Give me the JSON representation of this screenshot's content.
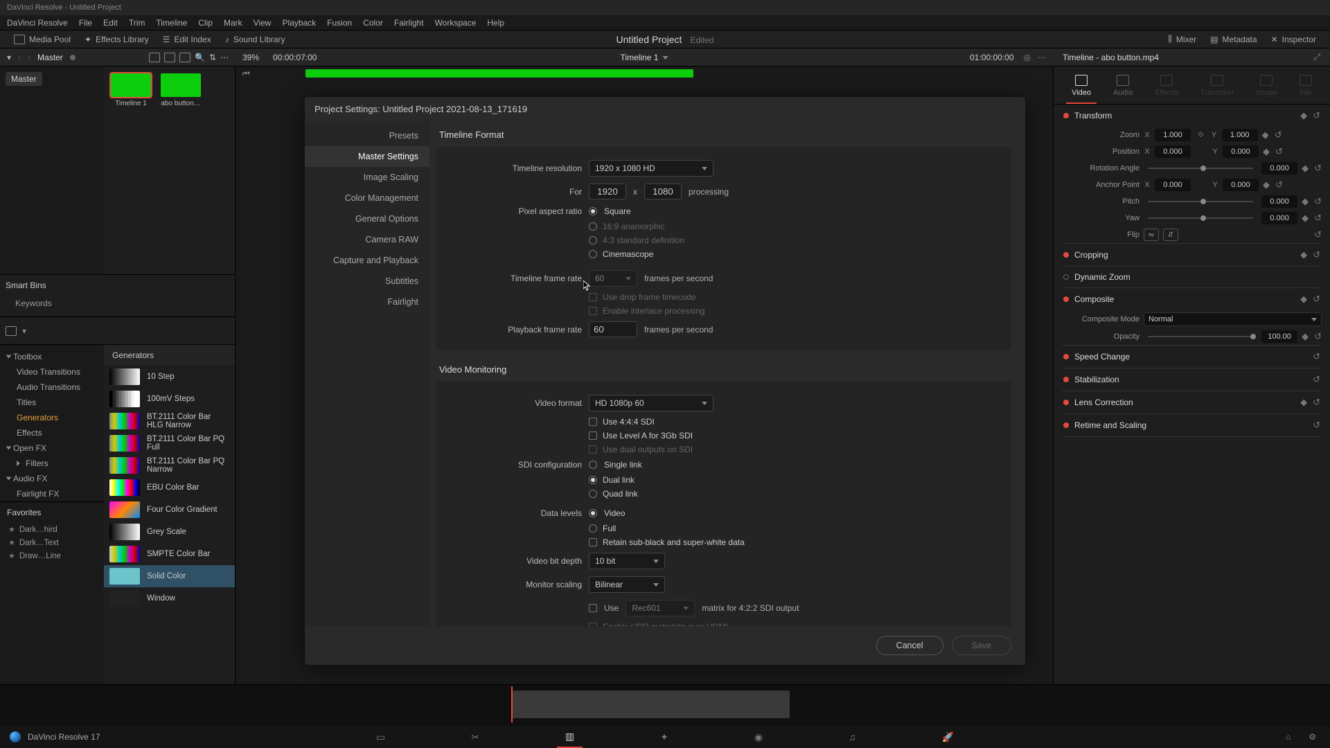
{
  "titlebar": "DaVinci Resolve - Untitled Project",
  "menubar": [
    "DaVinci Resolve",
    "File",
    "Edit",
    "Trim",
    "Timeline",
    "Clip",
    "Mark",
    "View",
    "Playback",
    "Fusion",
    "Color",
    "Fairlight",
    "Workspace",
    "Help"
  ],
  "toolbar": {
    "mediaPool": "Media Pool",
    "effectsLib": "Effects Library",
    "editIndex": "Edit Index",
    "soundLib": "Sound Library",
    "projectTitle": "Untitled Project",
    "edited": "Edited",
    "mixer": "Mixer",
    "metadata": "Metadata",
    "inspector": "Inspector"
  },
  "secondary": {
    "master": "Master",
    "zoom": "39%",
    "tcA": "00:00:07:00",
    "timelineName": "Timeline 1",
    "tcB": "01:00:00:00",
    "inspectorClip": "Timeline - abo button.mp4"
  },
  "bins": {
    "root": "Master",
    "thumbs": [
      {
        "label": "Timeline 1",
        "selected": true
      },
      {
        "label": "abo button…",
        "selected": false
      }
    ],
    "smartHdr": "Smart Bins",
    "smartItems": [
      "Keywords"
    ]
  },
  "toolbox": {
    "cats": [
      {
        "name": "Toolbox",
        "expand": true,
        "sub": [
          "Video Transitions",
          "Audio Transitions",
          "Titles",
          "Generators",
          "Effects"
        ],
        "activeSub": "Generators"
      },
      {
        "name": "Open FX",
        "expand": true,
        "sub": [
          "Filters"
        ]
      },
      {
        "name": "Audio FX",
        "expand": true,
        "sub": [
          "Fairlight FX"
        ]
      }
    ],
    "genHeader": "Generators",
    "generators": [
      {
        "name": "10 Step",
        "bg": "linear-gradient(90deg,#000,#fff)"
      },
      {
        "name": "100mV Steps",
        "bg": "linear-gradient(90deg,#000 0%,#000 10%,#222 10%,#222 20%,#444 20%,#444 30%,#666 30%,#666 40%,#888 40%,#888 50%,#aaa 50%,#aaa 60%,#ccc 60%,#ccc 70%,#eee 70%,#eee 80%,#fff 80%)"
      },
      {
        "name": "BT.2111 Color Bar HLG Narrow",
        "bg": "linear-gradient(90deg,#888,#cc0,#0cc,#0c0,#c0c,#c00,#00c)"
      },
      {
        "name": "BT.2111 Color Bar PQ Full",
        "bg": "linear-gradient(90deg,#888,#cc0,#0cc,#0c0,#c0c,#c00,#00c)"
      },
      {
        "name": "BT.2111 Color Bar PQ Narrow",
        "bg": "linear-gradient(90deg,#888,#cc0,#0cc,#0c0,#c0c,#c00,#00c)"
      },
      {
        "name": "EBU Color Bar",
        "bg": "linear-gradient(90deg,#fff,#ff0,#0ff,#0f0,#f0f,#f00,#00f,#000)"
      },
      {
        "name": "Four Color Gradient",
        "bg": "linear-gradient(135deg,#f0f,#f80 50%,#08f)"
      },
      {
        "name": "Grey Scale",
        "bg": "linear-gradient(90deg,#000,#fff)"
      },
      {
        "name": "SMPTE Color Bar",
        "bg": "linear-gradient(90deg,#ccc,#cc0,#0cc,#0c0,#c0c,#c00,#00c)"
      },
      {
        "name": "Solid Color",
        "bg": "#6bc4c9",
        "selected": true
      },
      {
        "name": "Window",
        "bg": "#222"
      }
    ],
    "favHdr": "Favorites",
    "favs": [
      "Dark…hird",
      "Dark…Text",
      "Draw…Line"
    ]
  },
  "inspector": {
    "tabs": [
      "Video",
      "Audio",
      "Effects",
      "Transition",
      "Image",
      "File"
    ],
    "activeTab": "Video",
    "transform": {
      "title": "Transform",
      "zoom": {
        "lbl": "Zoom",
        "x": "1.000",
        "y": "1.000"
      },
      "position": {
        "lbl": "Position",
        "x": "0.000",
        "y": "0.000"
      },
      "rotation": {
        "lbl": "Rotation Angle",
        "v": "0.000"
      },
      "anchor": {
        "lbl": "Anchor Point",
        "x": "0.000",
        "y": "0.000"
      },
      "pitch": {
        "lbl": "Pitch",
        "v": "0.000"
      },
      "yaw": {
        "lbl": "Yaw",
        "v": "0.000"
      },
      "flip": {
        "lbl": "Flip"
      }
    },
    "sections": [
      "Cropping",
      "Dynamic Zoom",
      "Composite",
      "Speed Change",
      "Stabilization",
      "Lens Correction",
      "Retime and Scaling"
    ],
    "composite": {
      "modeLbl": "Composite Mode",
      "mode": "Normal",
      "opacityLbl": "Opacity",
      "opacity": "100.00"
    }
  },
  "modal": {
    "title": "Project Settings:  Untitled Project 2021-08-13_171619",
    "sidebar": [
      "Presets",
      "Master Settings",
      "Image Scaling",
      "Color Management",
      "General Options",
      "Camera RAW",
      "Capture and Playback",
      "Subtitles",
      "Fairlight"
    ],
    "activeSidebar": "Master Settings",
    "tf": {
      "hdr": "Timeline Format",
      "resLbl": "Timeline resolution",
      "resVal": "1920 x 1080 HD",
      "forLbl": "For",
      "w": "1920",
      "xLbl": "x",
      "h": "1080",
      "proc": "processing",
      "parLbl": "Pixel aspect ratio",
      "parOpts": [
        "Square",
        "16:9 anamorphic",
        "4:3 standard definition",
        "Cinemascope"
      ],
      "tfrLbl": "Timeline frame rate",
      "tfrVal": "60",
      "fps": "frames per second",
      "drop": "Use drop frame timecode",
      "interlace": "Enable interlace processing",
      "pfrLbl": "Playback frame rate",
      "pfrVal": "60"
    },
    "vm": {
      "hdr": "Video Monitoring",
      "fmtLbl": "Video format",
      "fmtVal": "HD 1080p 60",
      "use444": "Use 4:4:4 SDI",
      "levelA": "Use Level A for 3Gb SDI",
      "dualOut": "Use dual outputs on SDI",
      "sdiLbl": "SDI configuration",
      "sdiOpts": [
        "Single link",
        "Dual link",
        "Quad link"
      ],
      "dataLbl": "Data levels",
      "dataOpts": [
        "Video",
        "Full"
      ],
      "retain": "Retain sub-black and super-white data",
      "depthLbl": "Video bit depth",
      "depthVal": "10 bit",
      "scaleLbl": "Monitor scaling",
      "scaleVal": "Bilinear",
      "useLbl": "Use",
      "rec": "Rec601",
      "matrix": "matrix for 4:2:2 SDI output",
      "hdrHdmi": "Enable HDR metadata over HDMI"
    },
    "cancel": "Cancel",
    "save": "Save"
  },
  "status": {
    "app": "DaVinci Resolve 17"
  }
}
